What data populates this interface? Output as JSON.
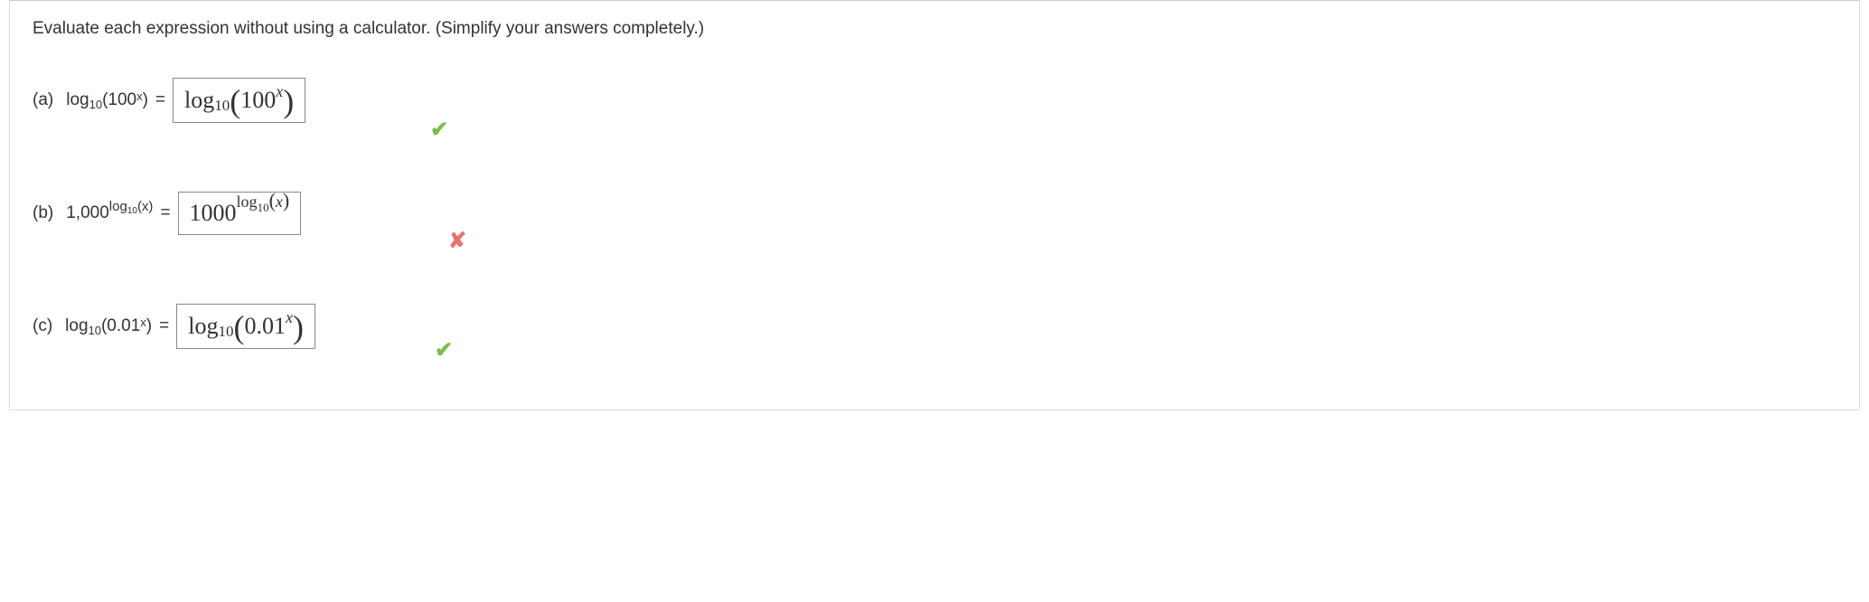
{
  "prompt": "Evaluate each expression without using a calculator. (Simplify your answers completely.)",
  "parts": {
    "a": {
      "label": "(a)",
      "expr_log": "log",
      "expr_base": "10",
      "expr_arg_open": "(100",
      "expr_arg_exp": "x",
      "expr_arg_close": ")",
      "eq": "=",
      "ans_log": "log",
      "ans_base": "10",
      "ans_paren_open": "(",
      "ans_inner": "100",
      "ans_inner_exp": "x",
      "ans_paren_close": ")",
      "feedback": "✔"
    },
    "b": {
      "label": "(b)",
      "expr_base_num": "1,000",
      "expr_exp_log": "log",
      "expr_exp_base": "10",
      "expr_exp_arg": "(x)",
      "eq": "=",
      "ans_base_num": "1000",
      "ans_exp_log": "log",
      "ans_exp_base": "10",
      "ans_exp_paren_open": "(",
      "ans_exp_arg": "x",
      "ans_exp_paren_close": ")",
      "feedback": "✘"
    },
    "c": {
      "label": "(c)",
      "expr_log": "log",
      "expr_base": "10",
      "expr_arg_open": "(0.01",
      "expr_arg_exp": "x",
      "expr_arg_close": ")",
      "eq": "=",
      "ans_log": "log",
      "ans_base": "10",
      "ans_paren_open": "(",
      "ans_inner": "0.01",
      "ans_inner_exp": "x",
      "ans_paren_close": ")",
      "feedback": "✔"
    }
  }
}
